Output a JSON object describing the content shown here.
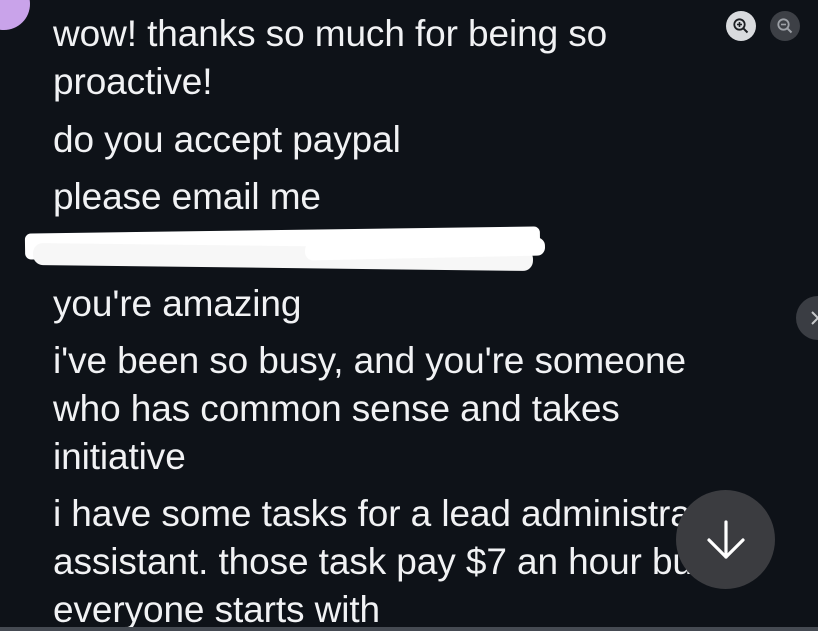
{
  "messages": [
    "wow! thanks so much for being so proactive!",
    "do you accept paypal",
    "please email me",
    "you're amazing",
    "i've been so busy, and you're someone who has common sense and takes initiative",
    "i have some tasks for a lead administrative assistant. those task pay $7 an hour but everyone starts with"
  ],
  "icons": {
    "zoom_in": "zoom-in-icon",
    "zoom_out": "zoom-out-icon",
    "next": "chevron-right-icon",
    "scroll_down": "arrow-down-icon"
  },
  "colors": {
    "background": "#0e1218",
    "text": "#f1f2f4",
    "avatar": "#c9a3ea",
    "button": "#3b3c40"
  }
}
